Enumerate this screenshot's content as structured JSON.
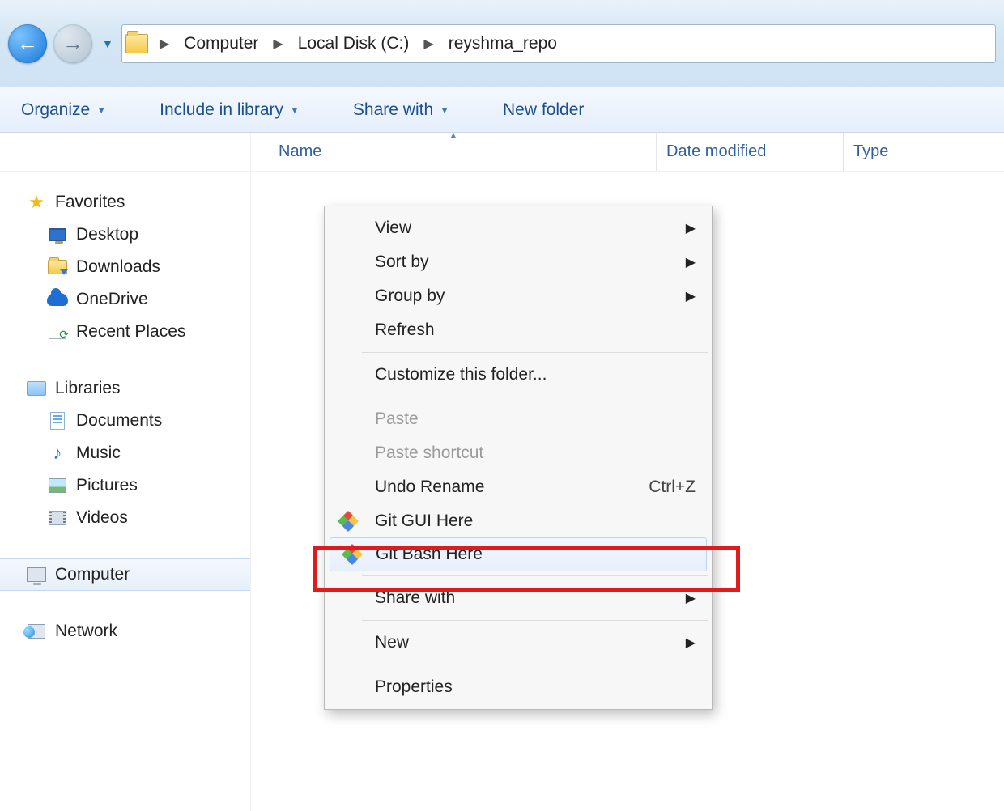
{
  "breadcrumb": {
    "segments": [
      "Computer",
      "Local Disk (C:)",
      "reyshma_repo"
    ]
  },
  "toolbar": {
    "organize": "Organize",
    "include": "Include in library",
    "share": "Share with",
    "new_folder": "New folder"
  },
  "columns": {
    "name": "Name",
    "date": "Date modified",
    "type": "Type"
  },
  "sidebar": {
    "favorites": {
      "label": "Favorites",
      "items": [
        {
          "label": "Desktop"
        },
        {
          "label": "Downloads"
        },
        {
          "label": "OneDrive"
        },
        {
          "label": "Recent Places"
        }
      ]
    },
    "libraries": {
      "label": "Libraries",
      "items": [
        {
          "label": "Documents"
        },
        {
          "label": "Music"
        },
        {
          "label": "Pictures"
        },
        {
          "label": "Videos"
        }
      ]
    },
    "computer": {
      "label": "Computer"
    },
    "network": {
      "label": "Network"
    }
  },
  "context_menu": {
    "view": "View",
    "sort_by": "Sort by",
    "group_by": "Group by",
    "refresh": "Refresh",
    "customize": "Customize this folder...",
    "paste": "Paste",
    "paste_shortcut": "Paste shortcut",
    "undo_rename": "Undo Rename",
    "undo_shortcut": "Ctrl+Z",
    "git_gui": "Git GUI Here",
    "git_bash": "Git Bash Here",
    "share_with": "Share with",
    "new": "New",
    "properties": "Properties"
  }
}
